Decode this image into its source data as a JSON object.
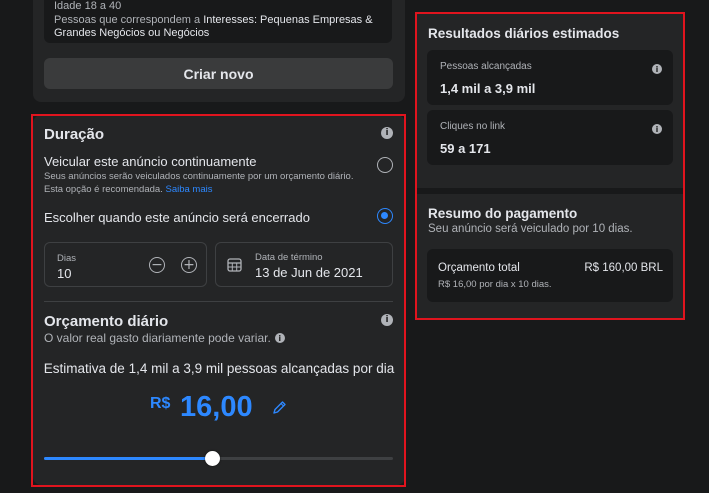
{
  "audience": {
    "age_line": "Idade 18 a 40",
    "interests_prefix": "Pessoas que correspondem a ",
    "interests_value": "Interesses: Pequenas Empresas & Grandes Negócios ou Negócios"
  },
  "create_button": "Criar novo",
  "duration": {
    "title": "Duração",
    "option_continuous": {
      "label": "Veicular este anúncio continuamente",
      "description": "Seus anúncios serão veiculados continuamente por um orçamento diário. Esta opção é recomendada.",
      "link": "Saiba mais",
      "selected": false
    },
    "option_end": {
      "label": "Escolher quando este anúncio será encerrado",
      "selected": true
    },
    "days": {
      "label": "Dias",
      "value": "10",
      "minus": "−",
      "plus": "+"
    },
    "end_date": {
      "label": "Data de término",
      "value": "13 de Jun de 2021"
    }
  },
  "budget": {
    "title": "Orçamento diário",
    "subtitle": "O valor real gasto diariamente pode variar.",
    "estimate": "Estimativa de 1,4 mil a 3,9 mil pessoas alcançadas por dia",
    "currency": "R$",
    "amount": "16,00",
    "slider_fraction": 0.48
  },
  "results": {
    "title": "Resultados diários estimados",
    "reach": {
      "label": "Pessoas alcançadas",
      "value": "1,4 mil a 3,9 mil"
    },
    "clicks": {
      "label": "Cliques no link",
      "value": "59 a 171"
    }
  },
  "payment": {
    "title": "Resumo do pagamento",
    "subtitle": "Seu anúncio será veiculado por 10 dias.",
    "total_label": "Orçamento total",
    "total_value": "R$ 160,00 BRL",
    "total_detail": "R$ 16,00 por dia x 10 dias."
  },
  "colors": {
    "accent": "#2d88ff",
    "highlight_frame": "#e0141e",
    "background": "#18191a",
    "card": "#242526"
  }
}
